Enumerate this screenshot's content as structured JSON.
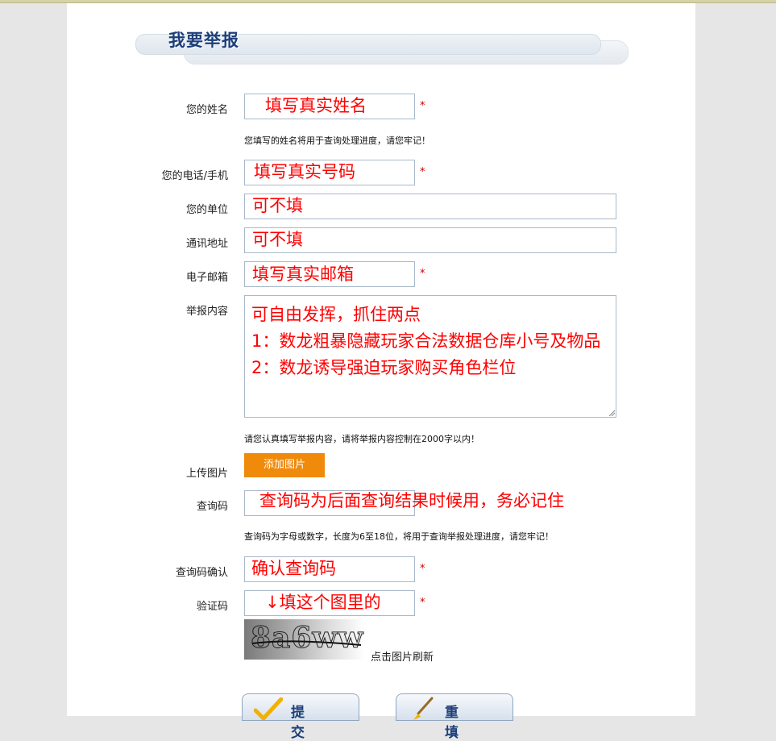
{
  "page": {
    "title": "我要举报"
  },
  "form": {
    "name": {
      "label": "您的姓名",
      "value": "填写真实姓名",
      "hint": "您填写的姓名将用于查询处理进度，请您牢记！"
    },
    "phone": {
      "label": "您的电话/手机",
      "value": "填写真实号码"
    },
    "company": {
      "label": "您的单位",
      "value": "可不填"
    },
    "address": {
      "label": "通讯地址",
      "value": "可不填"
    },
    "email": {
      "label": "电子邮箱",
      "value": "填写真实邮箱"
    },
    "content": {
      "label": "举报内容",
      "lines": [
        "可自由发挥，抓住两点",
        "1：数龙粗暴隐藏玩家合法数据仓库小号及物品",
        "2：数龙诱导强迫玩家购买角色栏位"
      ],
      "hint": "请您认真填写举报内容，请将举报内容控制在2000字以内！"
    },
    "upload": {
      "label": "上传图片",
      "button": "添加图片"
    },
    "query_code": {
      "label": "查询码",
      "value": "查询码为后面查询结果时候用，务必记住",
      "hint": "查询码为字母或数字，长度为6至18位，将用于查询举报处理进度，请您牢记！"
    },
    "query_confirm": {
      "label": "查询码确认",
      "value": "确认查询码"
    },
    "captcha": {
      "label": "验证码",
      "value": "↓填这个图里的",
      "image_text": "8a6ww",
      "refresh": "点击图片刷新"
    },
    "required_mark": "*"
  },
  "buttons": {
    "submit": "提 交",
    "reset": "重 填"
  }
}
